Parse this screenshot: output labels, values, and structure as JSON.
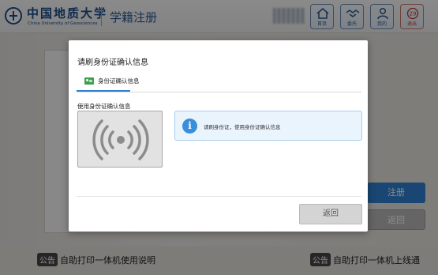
{
  "header": {
    "logo_cn": "中国地质大学",
    "logo_en": "China University of Geosciences",
    "title": "学籍注册",
    "buttons": {
      "home": "首页",
      "delegate": "委托",
      "mine": "我的",
      "exit": "退出",
      "exit_countdown": "29"
    }
  },
  "background": {
    "register_button": "注册",
    "return_button": "返回"
  },
  "footer": {
    "notice_tag": "公告",
    "notice1": "自助打印一体机使用说明",
    "notice2": "自助打印一体机上线通"
  },
  "dialog": {
    "title": "请刷身份证确认信息",
    "tab_label": "身份证确认信息",
    "section_label": "使用身份证确认信息",
    "info_text": "请刷身份证，使用身份证确认信息",
    "return_button": "返回"
  },
  "colors": {
    "brand_blue": "#1a4e8a",
    "accent_blue": "#2f80d1",
    "tab_green": "#3aa04a",
    "info_blue": "#3a8fdc",
    "exit_red": "#c0392b"
  },
  "icons": {
    "home": "home-icon",
    "delegate": "handshake-icon",
    "mine": "user-icon",
    "exit": "countdown-exit-icon",
    "reader": "card-reader-signal-icon",
    "info": "info-icon",
    "tab": "id-card-icon"
  }
}
